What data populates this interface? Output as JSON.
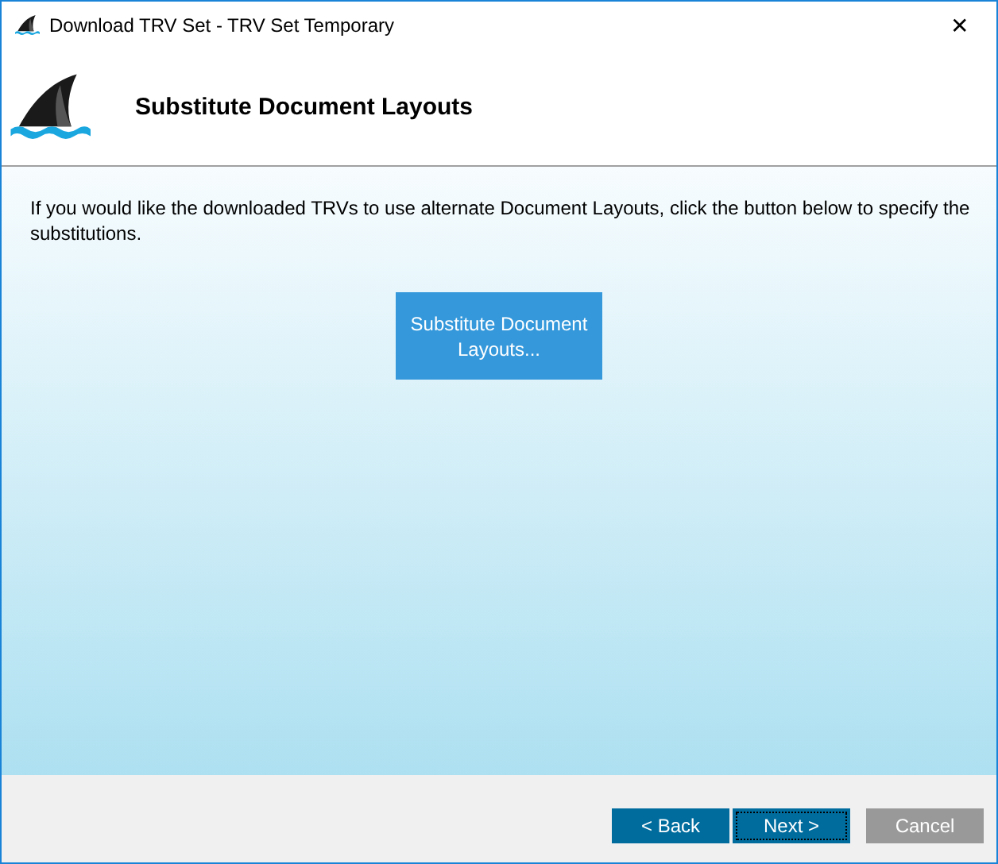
{
  "window": {
    "title": "Download TRV Set - TRV Set Temporary",
    "close": "✕"
  },
  "header": {
    "title": "Substitute Document Layouts"
  },
  "body": {
    "text": "If you would like the downloaded TRVs to use alternate Document Layouts, click the button below to specify the substitutions.",
    "button": "Substitute Document Layouts..."
  },
  "buttons": [
    {
      "label": "< Back",
      "focused": false,
      "disabled": false
    },
    {
      "label": "Next >",
      "focused": true,
      "disabled": false
    },
    {
      "label": "Cancel",
      "focused": false,
      "disabled": true
    }
  ]
}
